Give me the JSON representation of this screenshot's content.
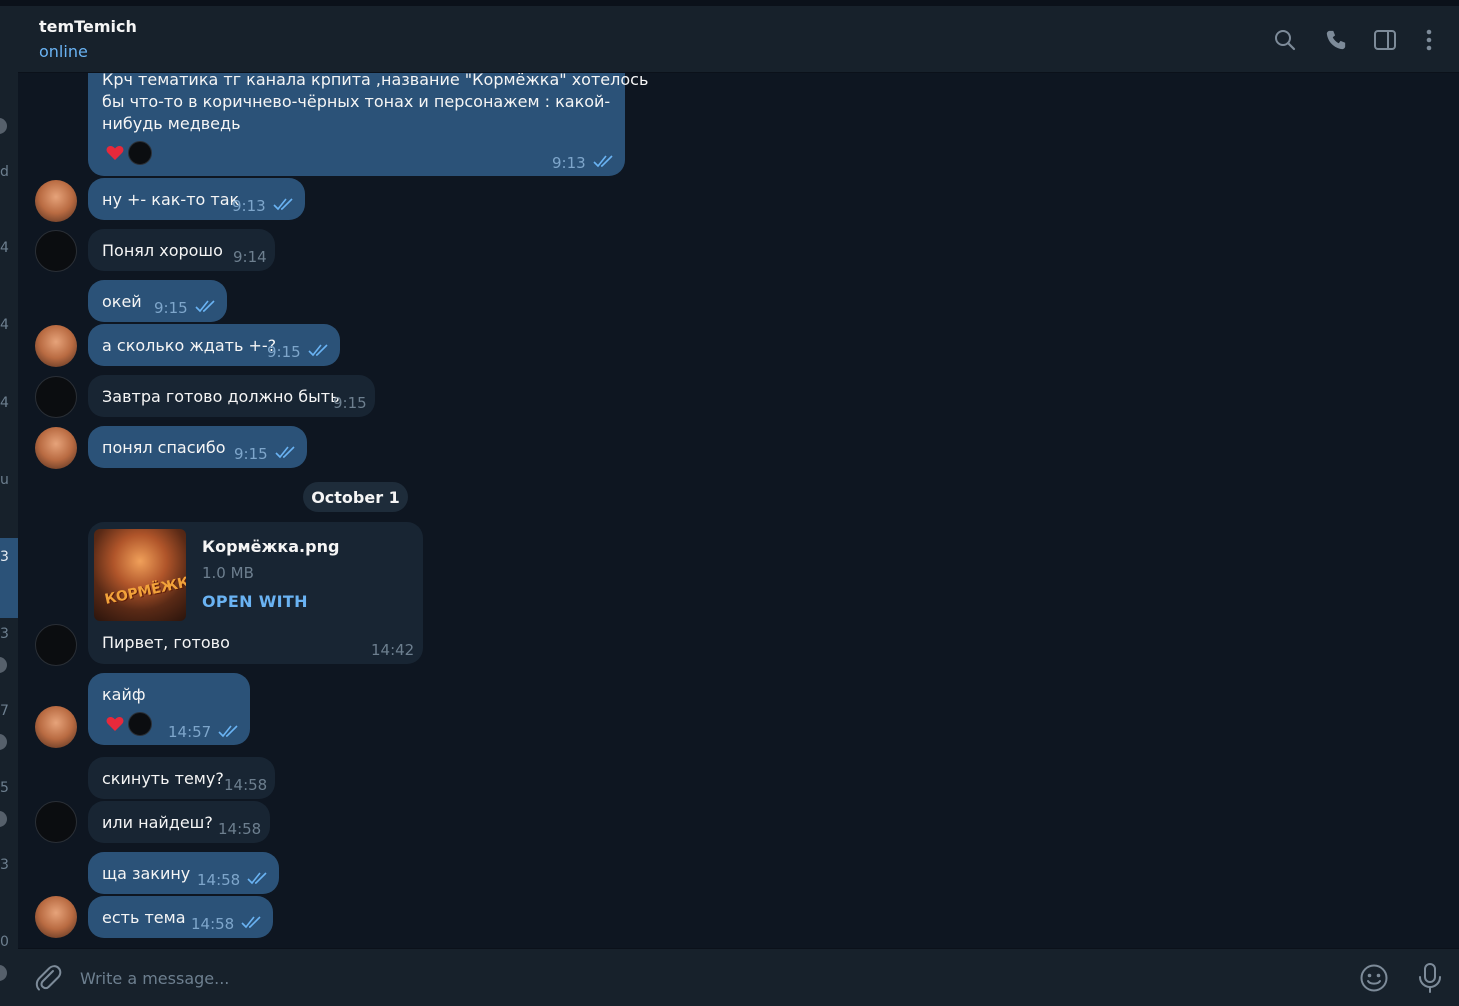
{
  "header": {
    "title": "temTemich",
    "status": "online",
    "icons": [
      "search-icon",
      "phone-icon",
      "sidebar-toggle-icon",
      "more-vertical-icon"
    ]
  },
  "left_strip": {
    "fragments": [
      "d",
      "4",
      "4",
      "4",
      "u",
      "3",
      "3",
      "7",
      "5",
      "3",
      "0"
    ]
  },
  "messages": [
    {
      "id": "m1",
      "direction": "out",
      "lines": [
        "Крч тематика тг канала крпита ,название \"Кормёжка\" хотелось",
        "бы что-то в коричнево-чёрных тонах и персонажем : какой-",
        "нибудь медведь"
      ],
      "time": "9:13",
      "read": true,
      "reactions": [
        "heart",
        "avatar"
      ]
    },
    {
      "id": "m2",
      "direction": "out",
      "text": "ну +- как-то так",
      "time": "9:13",
      "read": true
    },
    {
      "id": "m3",
      "direction": "in",
      "text": "Понял хорошо",
      "time": "9:14"
    },
    {
      "id": "m4",
      "direction": "out",
      "text": "окей",
      "time": "9:15",
      "read": true
    },
    {
      "id": "m5",
      "direction": "out",
      "text": "а сколько ждать +-?",
      "time": "9:15",
      "read": true
    },
    {
      "id": "m6",
      "direction": "in",
      "text": "Завтра готово должно быть",
      "time": "9:15"
    },
    {
      "id": "m7",
      "direction": "out",
      "text": "понял спасибо",
      "time": "9:15",
      "read": true
    },
    {
      "id": "m8",
      "direction": "in",
      "file": {
        "name": "Кормёжка.png",
        "size": "1.0 MB",
        "action": "OPEN WITH",
        "thumb_text": "КОРМЁЖКА"
      },
      "text": "Пирвет, готово",
      "time": "14:42"
    },
    {
      "id": "m9",
      "direction": "out",
      "text": "кайф",
      "time": "14:57",
      "read": true,
      "reactions": [
        "heart",
        "avatar"
      ]
    },
    {
      "id": "m10",
      "direction": "in",
      "text": "скинуть тему?",
      "time": "14:58"
    },
    {
      "id": "m11",
      "direction": "in",
      "text": "или найдеш?",
      "time": "14:58"
    },
    {
      "id": "m12",
      "direction": "out",
      "text": "ща закину",
      "time": "14:58",
      "read": true
    },
    {
      "id": "m13",
      "direction": "out",
      "text": "есть тема",
      "time": "14:58",
      "read": true
    }
  ],
  "date_separator": "October 1",
  "composer": {
    "placeholder": "Write a message...",
    "icons": [
      "attach-icon",
      "emoji-icon",
      "microphone-icon"
    ]
  },
  "colors": {
    "background": "#0e1621",
    "panel": "#17212b",
    "outgoing_bubble": "#2b5278",
    "incoming_bubble": "#182533",
    "accent": "#6ab3f3",
    "muted": "#6d7f8f"
  }
}
